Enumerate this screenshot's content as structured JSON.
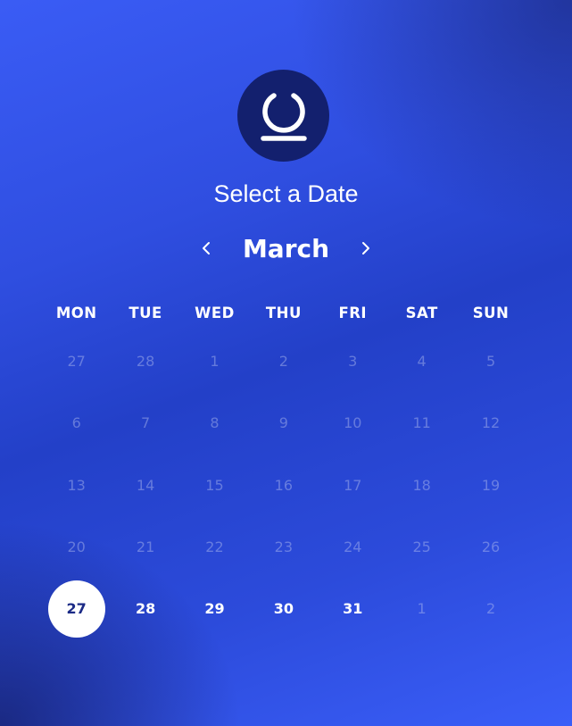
{
  "header": {
    "logo_icon": "power-ring-icon",
    "title": "Select a Date"
  },
  "nav": {
    "prev_icon": "chevron-left-icon",
    "month": "March",
    "next_icon": "chevron-right-icon"
  },
  "weekdays": [
    "MON",
    "TUE",
    "WED",
    "THU",
    "FRI",
    "SAT",
    "SUN"
  ],
  "weeks": [
    [
      {
        "label": "27",
        "state": "muted"
      },
      {
        "label": "28",
        "state": "muted"
      },
      {
        "label": "1",
        "state": "muted"
      },
      {
        "label": "2",
        "state": "muted"
      },
      {
        "label": "3",
        "state": "muted"
      },
      {
        "label": "4",
        "state": "muted"
      },
      {
        "label": "5",
        "state": "muted"
      }
    ],
    [
      {
        "label": "6",
        "state": "muted"
      },
      {
        "label": "7",
        "state": "muted"
      },
      {
        "label": "8",
        "state": "muted"
      },
      {
        "label": "9",
        "state": "muted"
      },
      {
        "label": "10",
        "state": "muted"
      },
      {
        "label": "11",
        "state": "muted"
      },
      {
        "label": "12",
        "state": "muted"
      }
    ],
    [
      {
        "label": "13",
        "state": "muted"
      },
      {
        "label": "14",
        "state": "muted"
      },
      {
        "label": "15",
        "state": "muted"
      },
      {
        "label": "16",
        "state": "muted"
      },
      {
        "label": "17",
        "state": "muted"
      },
      {
        "label": "18",
        "state": "muted"
      },
      {
        "label": "19",
        "state": "muted"
      }
    ],
    [
      {
        "label": "20",
        "state": "muted"
      },
      {
        "label": "21",
        "state": "muted"
      },
      {
        "label": "22",
        "state": "muted"
      },
      {
        "label": "23",
        "state": "muted"
      },
      {
        "label": "24",
        "state": "muted"
      },
      {
        "label": "25",
        "state": "muted"
      },
      {
        "label": "26",
        "state": "muted"
      }
    ],
    [
      {
        "label": "27",
        "state": "selected"
      },
      {
        "label": "28",
        "state": "active"
      },
      {
        "label": "29",
        "state": "active"
      },
      {
        "label": "30",
        "state": "active"
      },
      {
        "label": "31",
        "state": "active"
      },
      {
        "label": "1",
        "state": "muted"
      },
      {
        "label": "2",
        "state": "muted"
      }
    ]
  ],
  "colors": {
    "background_start": "#3a5cf5",
    "background_dark": "#13206e",
    "selected_fill": "#ffffff",
    "selected_text": "#1b2a86"
  }
}
